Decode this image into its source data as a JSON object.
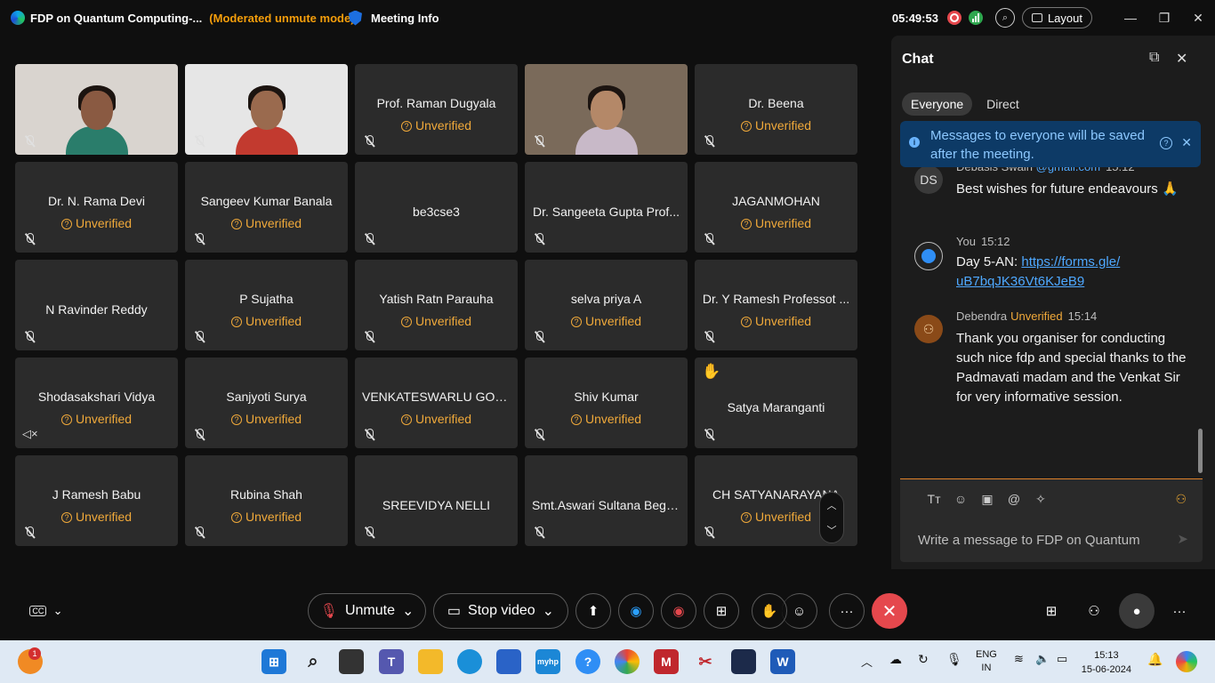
{
  "titlebar": {
    "title": "FDP on Quantum Computing-...",
    "mode": "(Moderated unmute mode)",
    "meeting_info": "Meeting Info",
    "clock": "05:49:53",
    "layout_label": "Layout"
  },
  "participants": [
    {
      "name": "",
      "video": true,
      "skin": "#8a5a42",
      "shirt": "#2a7d6b",
      "bg": "#d9d4cf"
    },
    {
      "name": "",
      "video": true,
      "skin": "#9a6a4e",
      "shirt": "#c23a2f",
      "bg": "#e6e6e6"
    },
    {
      "name": "Prof. Raman Dugyala",
      "unverified": true
    },
    {
      "name": "",
      "video": true,
      "skin": "#b48868",
      "shirt": "#c8b9c8",
      "bg": "#7a6a5a"
    },
    {
      "name": "Dr. Beena",
      "unverified": true
    },
    {
      "name": "Dr. N. Rama Devi",
      "unverified": true
    },
    {
      "name": "Sangeev Kumar Banala",
      "unverified": true
    },
    {
      "name": "be3cse3",
      "unverified": false
    },
    {
      "name": "Dr. Sangeeta Gupta Prof...",
      "unverified": false
    },
    {
      "name": "JAGANMOHAN",
      "unverified": true
    },
    {
      "name": "N Ravinder Reddy",
      "unverified": false
    },
    {
      "name": "P Sujatha",
      "unverified": true
    },
    {
      "name": "Yatish Ratn Parauha",
      "unverified": true
    },
    {
      "name": "selva priya A",
      "unverified": true
    },
    {
      "name": "Dr. Y Ramesh Professot ...",
      "unverified": true
    },
    {
      "name": "Shodasakshari Vidya",
      "unverified": true,
      "speaker": true
    },
    {
      "name": "Sanjyoti Surya",
      "unverified": true
    },
    {
      "name": "VENKATESWARLU GOLLA",
      "unverified": true
    },
    {
      "name": "Shiv Kumar",
      "unverified": true
    },
    {
      "name": "Satya Maranganti",
      "unverified": false,
      "hand": true
    },
    {
      "name": "J Ramesh Babu",
      "unverified": true
    },
    {
      "name": "Rubina Shah",
      "unverified": true
    },
    {
      "name": "SREEVIDYA NELLI",
      "unverified": false
    },
    {
      "name": "Smt.Aswari Sultana Begu...",
      "unverified": false
    },
    {
      "name": "CH SATYANARAYANA",
      "unverified": true
    }
  ],
  "unverified_label": "Unverified",
  "chat": {
    "title": "Chat",
    "tabs": [
      "Everyone",
      "Direct"
    ],
    "notice": "Messages to everyone will be saved after the meeting.",
    "messages": [
      {
        "initials": "DS",
        "sender": "Debasis Swain",
        "extra": "@gmail.com",
        "time": "15:12",
        "text": "Best wishes for future endeavours 🙏"
      },
      {
        "initials": "",
        "sender": "You",
        "time": "15:12",
        "text_prefix": "Day 5-AN: ",
        "link": "https://forms.gle/uB7bqJK36Vt6KJeB9",
        "link_display_1": "https://forms.gle/",
        "link_display_2": "uB7bqJK36Vt6KJeB9"
      },
      {
        "initials": "",
        "sender": "Debendra",
        "unverified": "Unverified",
        "time": "15:14",
        "text": "Thank you organiser for conducting such nice fdp and special thanks to the Padmavati madam and the Venkat Sir for very informative session."
      }
    ],
    "input_placeholder": "Write a message to FDP on Quantum"
  },
  "controls": {
    "unmute": "Unmute",
    "stop_video": "Stop video"
  },
  "taskbar": {
    "lang_1": "ENG",
    "lang_2": "IN",
    "time": "15:13",
    "date": "15-06-2024",
    "notif_count": "1"
  },
  "colors": {
    "unverified": "#f0a93a",
    "leave": "#e5484d",
    "link": "#4ea8ff",
    "notice_bg": "#0d3a66"
  }
}
